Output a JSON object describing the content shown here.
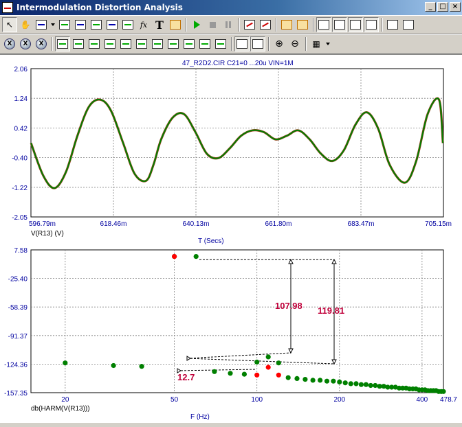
{
  "window": {
    "title": "Intermodulation Distortion Analysis",
    "caption_buttons": [
      "_",
      "□",
      "×"
    ]
  },
  "toolbar1": {
    "items": [
      "select-tool",
      "pan-tool",
      "copy",
      "dropdown",
      "scale",
      "format",
      "graph",
      "chart",
      "label",
      "fx",
      "text",
      "marker",
      "run",
      "stop",
      "pause",
      "cursor-red",
      "cursor-green",
      "window1",
      "window2",
      "layout1",
      "layout2",
      "layout3",
      "layout4",
      "tile-h",
      "tile-v"
    ]
  },
  "toolbar2": {
    "items": [
      "x1",
      "x2",
      "x3",
      "peak",
      "valley",
      "high",
      "low",
      "up",
      "down",
      "left",
      "right",
      "slope",
      "inflect",
      "tag",
      "fit-x",
      "fit-y",
      "zoom-in",
      "zoom-out",
      "grid"
    ]
  },
  "colors": {
    "axis_text": "#0000a0",
    "trace_green": "#008000",
    "trace_red": "#ff0000",
    "annotation": "#c0003a",
    "grid": "#808080"
  },
  "top_plot": {
    "title": "47_R2D2.CIR C21=0 ...20u VIN=1M",
    "trace_label": "V(R13) (V)",
    "x_axis_label": "T (Secs)",
    "y_ticks": [
      "2.06",
      "1.24",
      "0.42",
      "-0.40",
      "-1.22",
      "-2.05"
    ],
    "x_ticks": [
      "596.79m",
      "618.46m",
      "640.13m",
      "661.80m",
      "683.47m",
      "705.15m"
    ]
  },
  "bottom_plot": {
    "trace_label": "db(HARM(V(R13)))",
    "x_axis_label": "F (Hz)",
    "y_ticks": [
      "7.58",
      "-25.40",
      "-58.39",
      "-91.37",
      "-124.36",
      "-157.35"
    ],
    "x_ticks": [
      "20",
      "50",
      "100",
      "200",
      "400",
      "478.7"
    ],
    "annotations": {
      "delta1": "107.98",
      "delta2": "119.81",
      "delta3": "12.7"
    }
  },
  "chart_data": [
    {
      "type": "line",
      "title": "47_R2D2.CIR C21=0 ...20u VIN=1M",
      "xlabel": "T (Secs)",
      "ylabel": "V(R13) (V)",
      "xlim": [
        0.59679,
        0.70515
      ],
      "ylim": [
        -2.05,
        2.06
      ],
      "series": [
        {
          "name": "V(R13) (V)",
          "x": [
            0.5968,
            0.6,
            0.603,
            0.606,
            0.609,
            0.612,
            0.615,
            0.6178,
            0.621,
            0.624,
            0.627,
            0.629,
            0.631,
            0.634,
            0.637,
            0.64,
            0.643,
            0.646,
            0.649,
            0.652,
            0.655,
            0.658,
            0.661,
            0.664,
            0.667,
            0.67,
            0.673,
            0.676,
            0.679,
            0.682,
            0.685,
            0.688,
            0.691,
            0.695,
            0.698,
            0.701,
            0.704,
            0.705
          ],
          "y": [
            0.0,
            -0.9,
            -1.25,
            -0.8,
            0.2,
            1.0,
            1.2,
            0.9,
            0.0,
            -0.85,
            -1.05,
            -0.6,
            0.1,
            0.7,
            0.8,
            0.3,
            -0.3,
            -0.42,
            -0.15,
            0.2,
            0.35,
            0.3,
            0.1,
            0.2,
            0.35,
            0.1,
            -0.3,
            -0.5,
            -0.2,
            0.5,
            0.85,
            0.4,
            -0.6,
            -1.1,
            -0.5,
            0.8,
            1.2,
            0.0
          ]
        }
      ]
    },
    {
      "type": "scatter",
      "xlabel": "F (Hz)",
      "ylabel": "db(HARM(V(R13)))",
      "xscale": "log",
      "xlim": [
        15,
        478.7
      ],
      "ylim": [
        -157.35,
        7.58
      ],
      "series": [
        {
          "name": "db(HARM(V(R13)))",
          "color": "#008000",
          "points": [
            [
              20,
              -123
            ],
            [
              30,
              -126
            ],
            [
              38,
              -127
            ],
            [
              50,
              0
            ],
            [
              60,
              0
            ],
            [
              70,
              -133
            ],
            [
              80,
              -135
            ],
            [
              90,
              -136
            ],
            [
              100,
              -122
            ],
            [
              110,
              -116
            ],
            [
              120,
              -123
            ],
            [
              130,
              -140
            ],
            [
              140,
              -141
            ],
            [
              150,
              -142
            ],
            [
              160,
              -143
            ],
            [
              170,
              -143
            ],
            [
              180,
              -144
            ],
            [
              190,
              -144
            ],
            [
              200,
              -145
            ],
            [
              210,
              -146
            ],
            [
              220,
              -147
            ],
            [
              230,
              -147
            ],
            [
              240,
              -148
            ],
            [
              250,
              -148
            ],
            [
              260,
              -149
            ],
            [
              270,
              -149
            ],
            [
              280,
              -150
            ],
            [
              290,
              -150
            ],
            [
              300,
              -151
            ],
            [
              310,
              -151
            ],
            [
              320,
              -151
            ],
            [
              330,
              -152
            ],
            [
              340,
              -152
            ],
            [
              350,
              -152
            ],
            [
              360,
              -153
            ],
            [
              370,
              -153
            ],
            [
              380,
              -153
            ],
            [
              390,
              -154
            ],
            [
              400,
              -154
            ],
            [
              410,
              -154
            ],
            [
              420,
              -155
            ],
            [
              430,
              -155
            ],
            [
              440,
              -155
            ],
            [
              450,
              -155
            ],
            [
              460,
              -156
            ],
            [
              470,
              -156
            ],
            [
              478.7,
              -156
            ]
          ]
        },
        {
          "name": "intermod",
          "color": "#ff0000",
          "points": [
            [
              50,
              0
            ],
            [
              100,
              -137
            ],
            [
              110,
              -128
            ],
            [
              120,
              -137
            ]
          ]
        }
      ]
    }
  ]
}
